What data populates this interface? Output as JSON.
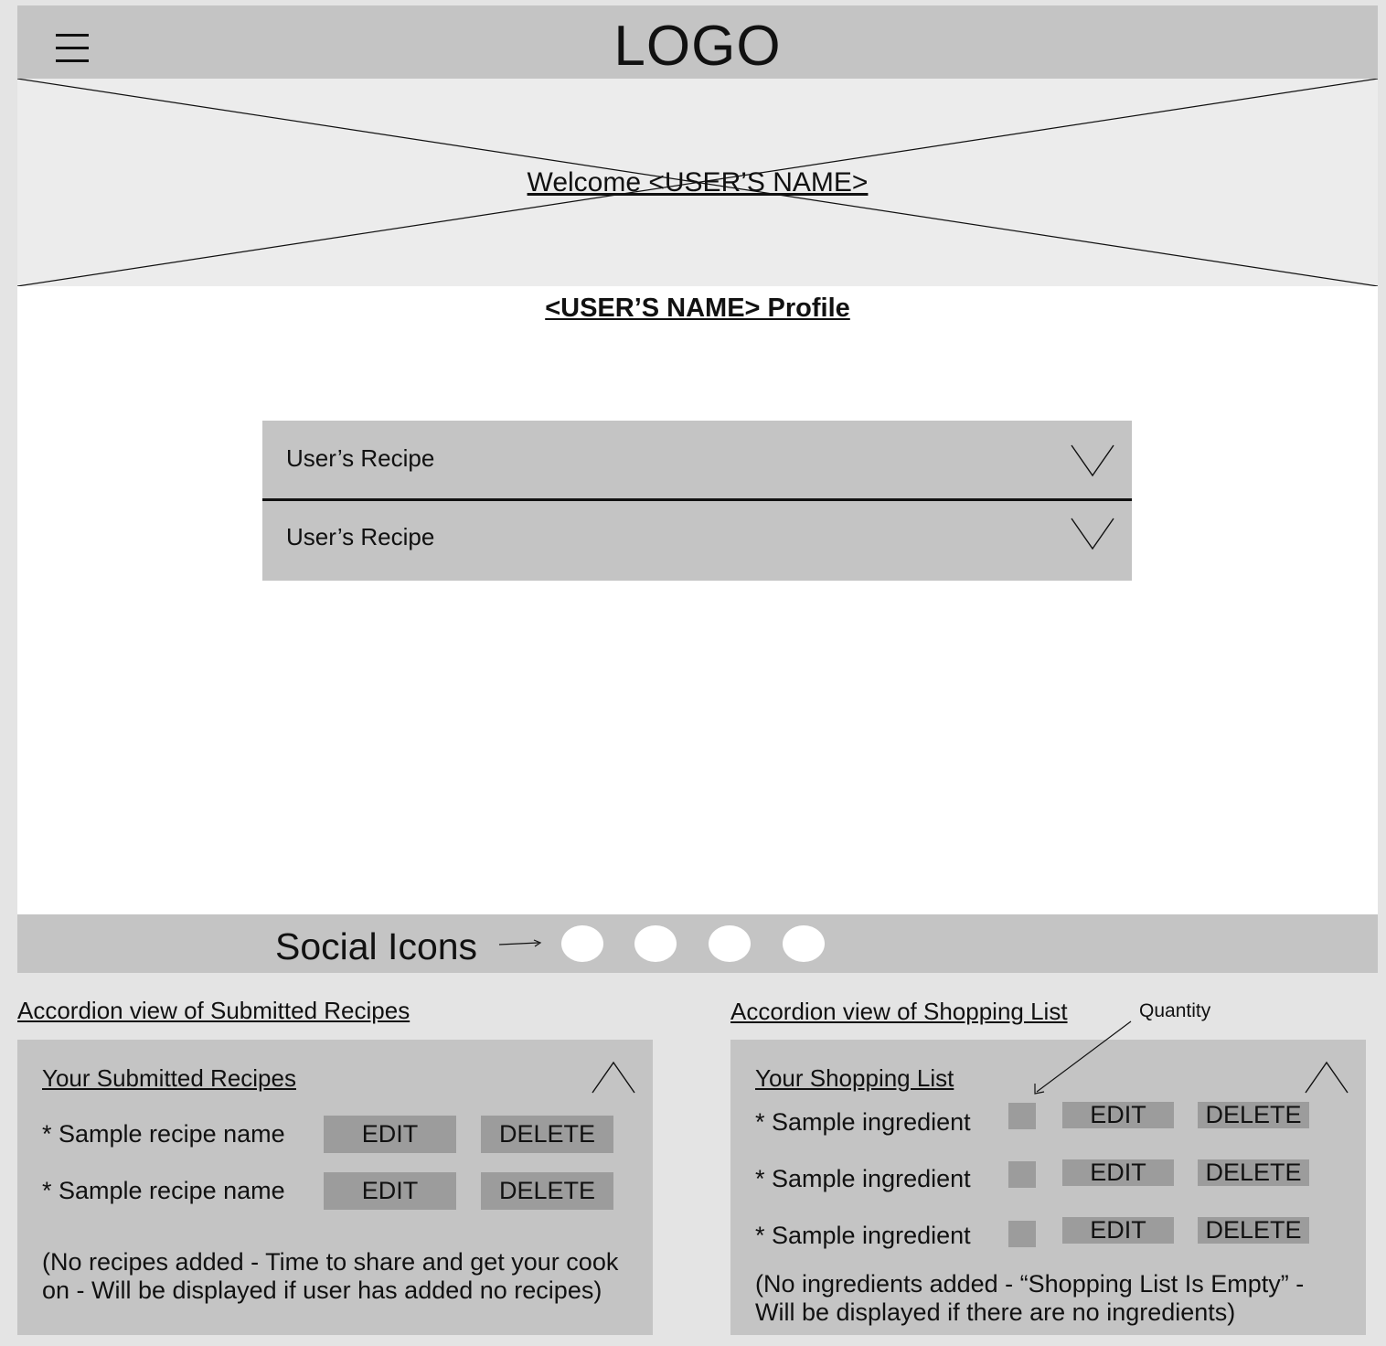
{
  "header": {
    "menu_icon": "hamburger-menu-icon",
    "logo_text": "LOGO"
  },
  "hero": {
    "welcome_text": "Welcome <USER’S NAME>"
  },
  "profile": {
    "title": "<USER’S NAME> Profile",
    "accordion": [
      {
        "label": "User’s Recipe",
        "icon": "chevron-down-icon"
      },
      {
        "label": "User’s Recipe",
        "icon": "chevron-down-icon"
      }
    ]
  },
  "footer": {
    "social_label": "Social Icons",
    "arrow_icon": "arrow-right-icon",
    "social_icons": [
      "social-icon-1",
      "social-icon-2",
      "social-icon-3",
      "social-icon-4"
    ]
  },
  "submitted_recipes": {
    "section_title": "Accordion view of Submitted Recipes",
    "panel_title": "Your  Submitted Recipes",
    "collapse_icon": "chevron-up-icon",
    "items": [
      {
        "name": "* Sample recipe name",
        "edit_label": "EDIT",
        "delete_label": "DELETE"
      },
      {
        "name": "* Sample recipe name",
        "edit_label": "EDIT",
        "delete_label": "DELETE"
      }
    ],
    "empty_note_line1": "(No recipes added - Time to share and get your cook",
    "empty_note_line2": "on - Will be displayed if user has added no recipes)"
  },
  "shopping_list": {
    "section_title": "Accordion view of Shopping List",
    "quantity_annotation": "Quantity",
    "panel_title": "Your Shopping List",
    "collapse_icon": "chevron-up-icon",
    "items": [
      {
        "name": "* Sample ingredient",
        "edit_label": "EDIT",
        "delete_label": "DELETE"
      },
      {
        "name": "* Sample ingredient",
        "edit_label": "EDIT",
        "delete_label": "DELETE"
      },
      {
        "name": "* Sample ingredient",
        "edit_label": "EDIT",
        "delete_label": "DELETE"
      }
    ],
    "empty_note_line1": "(No ingredients added  -  “Shopping List Is Empty” -",
    "empty_note_line2": "Will be displayed if there are no ingredients)"
  },
  "colors": {
    "page_bg": "#e4e4e4",
    "header_bg": "#c4c4c4",
    "hero_bg": "#ececec",
    "button_bg": "#9c9c9c"
  }
}
